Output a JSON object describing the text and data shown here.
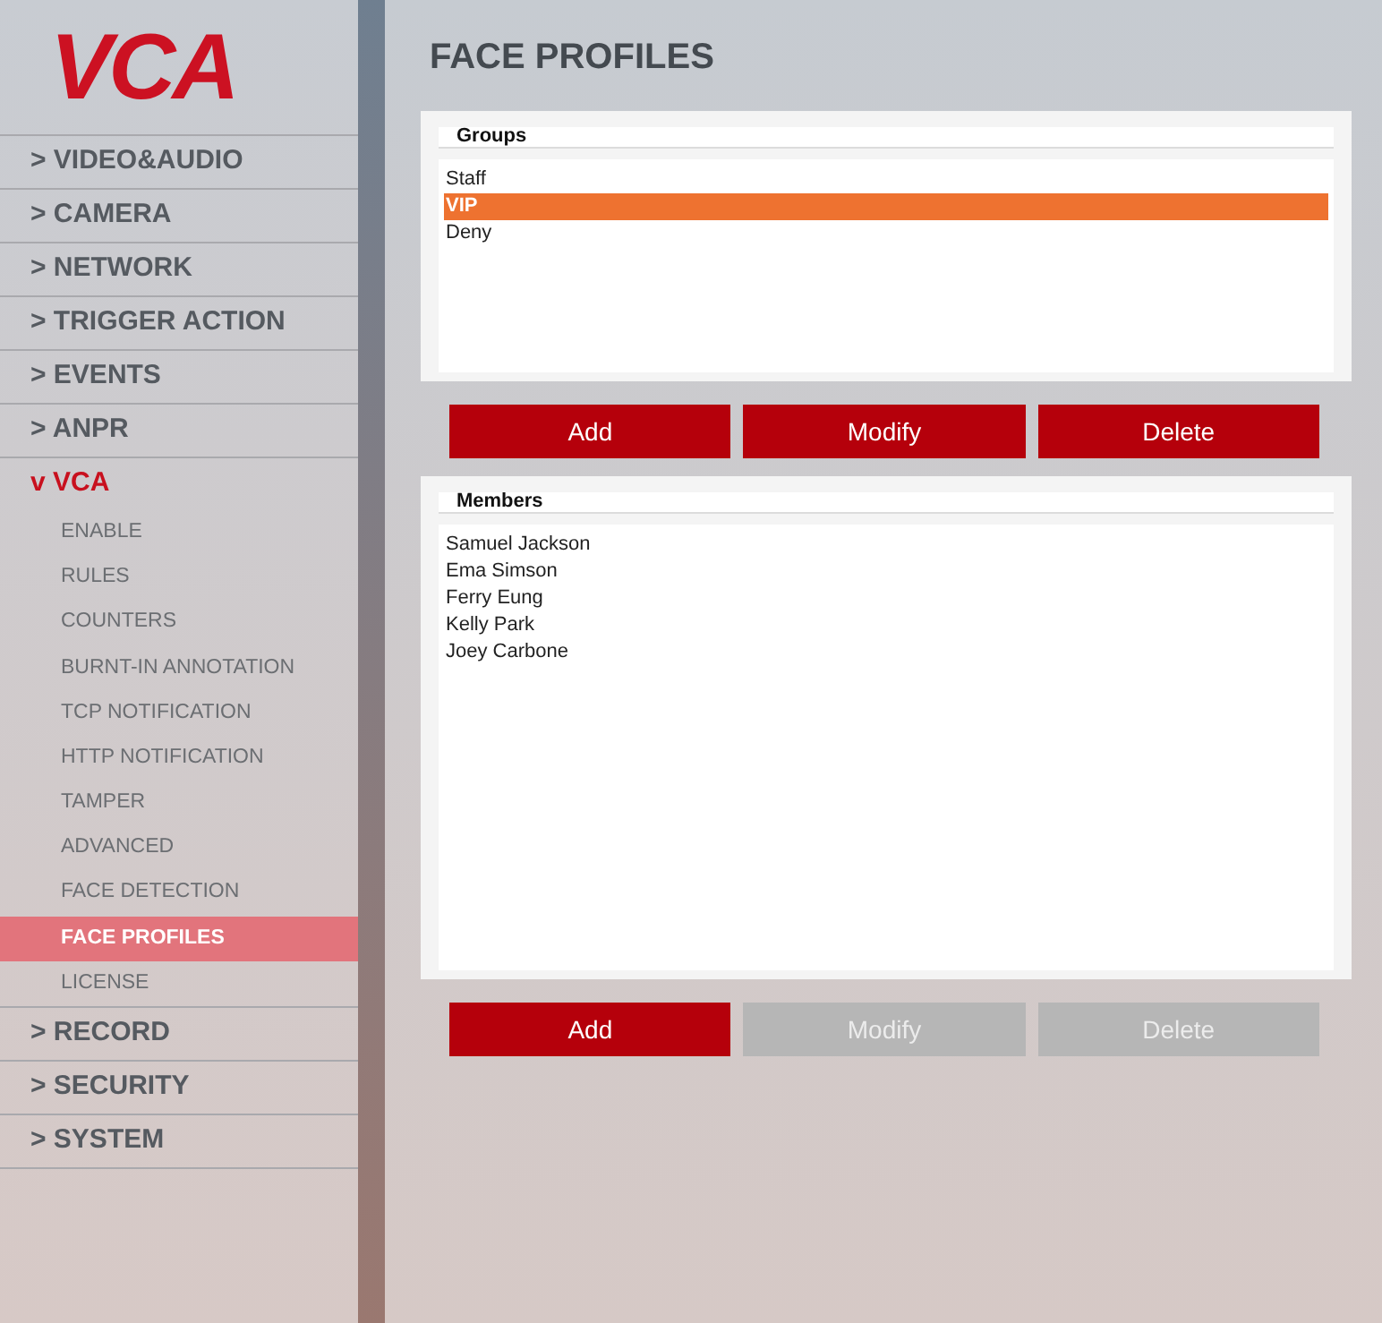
{
  "logo": "VCA",
  "sidebar": {
    "items": [
      {
        "label": "> VIDEO&AUDIO",
        "expanded": false
      },
      {
        "label": "> CAMERA",
        "expanded": false
      },
      {
        "label": "> NETWORK",
        "expanded": false
      },
      {
        "label": "> TRIGGER ACTION",
        "expanded": false
      },
      {
        "label": "> EVENTS",
        "expanded": false
      },
      {
        "label": "> ANPR",
        "expanded": false
      },
      {
        "label": "v VCA",
        "expanded": true,
        "children": [
          {
            "label": "ENABLE",
            "selected": false
          },
          {
            "label": "RULES",
            "selected": false
          },
          {
            "label": "COUNTERS",
            "selected": false
          },
          {
            "label": "BURNT-IN ANNOTATION",
            "selected": false
          },
          {
            "label": "TCP NOTIFICATION",
            "selected": false
          },
          {
            "label": "HTTP NOTIFICATION",
            "selected": false
          },
          {
            "label": "TAMPER",
            "selected": false
          },
          {
            "label": "ADVANCED",
            "selected": false
          },
          {
            "label": "FACE DETECTION",
            "selected": false
          },
          {
            "label": "FACE PROFILES",
            "selected": true
          },
          {
            "label": "LICENSE",
            "selected": false
          }
        ]
      },
      {
        "label": "> RECORD",
        "expanded": false
      },
      {
        "label": "> SECURITY",
        "expanded": false
      },
      {
        "label": "> SYSTEM",
        "expanded": false
      }
    ]
  },
  "page_title": "FACE PROFILES",
  "panels": [
    {
      "title": "Groups",
      "items": [
        {
          "label": "Staff",
          "selected": false
        },
        {
          "label": "VIP",
          "selected": true
        },
        {
          "label": "Deny",
          "selected": false
        }
      ],
      "buttons": [
        {
          "label": "Add",
          "disabled": false
        },
        {
          "label": "Modify",
          "disabled": false
        },
        {
          "label": "Delete",
          "disabled": false
        }
      ]
    },
    {
      "title": "Members",
      "items": [
        {
          "label": "Samuel Jackson",
          "selected": false
        },
        {
          "label": "Ema Simson",
          "selected": false
        },
        {
          "label": "Ferry Eung",
          "selected": false
        },
        {
          "label": "Kelly Park",
          "selected": false
        },
        {
          "label": "Joey Carbone",
          "selected": false
        }
      ],
      "buttons": [
        {
          "label": "Add",
          "disabled": false
        },
        {
          "label": "Modify",
          "disabled": true
        },
        {
          "label": "Delete",
          "disabled": true
        }
      ]
    }
  ]
}
